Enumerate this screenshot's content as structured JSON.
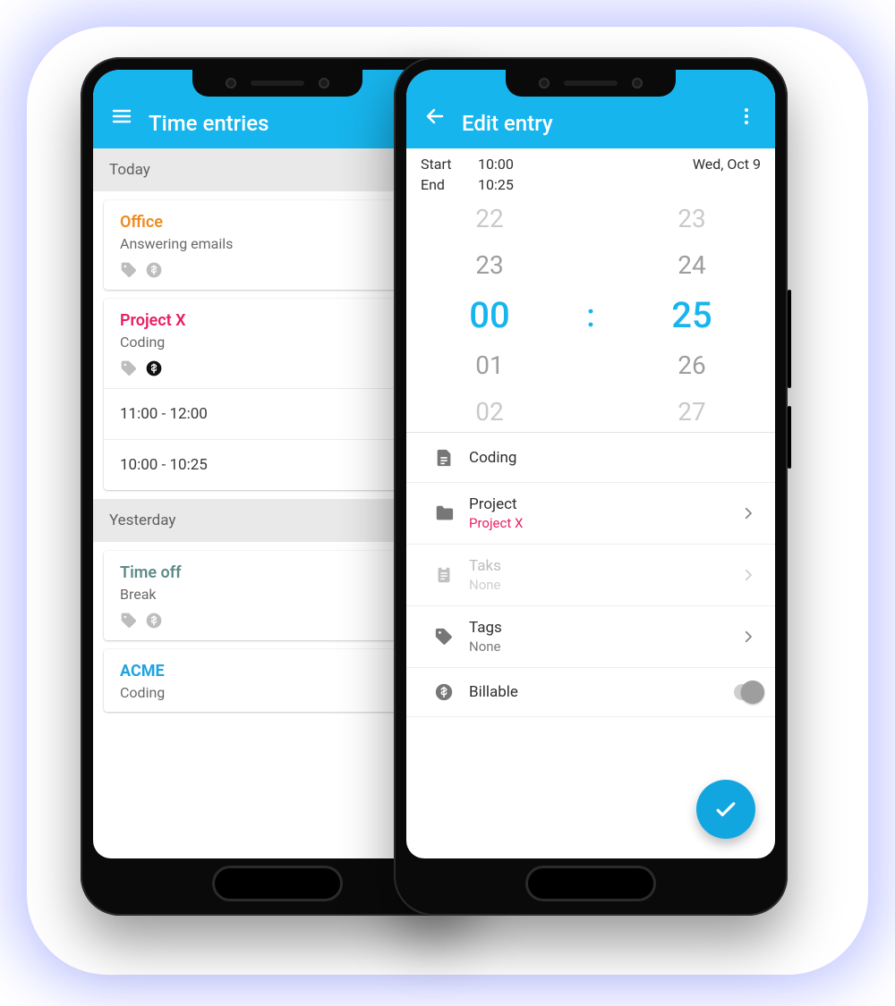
{
  "colors": {
    "primary": "#17b5ed",
    "orange": "#f08a1d",
    "pink": "#e91e63",
    "teal": "#5d8a8a",
    "blue": "#1fa4e0"
  },
  "left": {
    "title": "Time entries",
    "sections": [
      {
        "header": "Today",
        "cards": [
          {
            "project": "Office",
            "project_color": "orange",
            "description": "Answering emails",
            "billable_active": false,
            "sub_rows": []
          },
          {
            "project": "Project X",
            "project_color": "pink",
            "description": "Coding",
            "billable_active": true,
            "sub_rows": [
              "11:00 - 12:00",
              "10:00 - 10:25"
            ]
          }
        ]
      },
      {
        "header": "Yesterday",
        "cards": [
          {
            "project": "Time off",
            "project_color": "teal",
            "description": "Break",
            "billable_active": false,
            "sub_rows": []
          },
          {
            "project": "ACME",
            "project_color": "blue",
            "description": "Coding",
            "billable_active": false,
            "sub_rows": []
          }
        ]
      }
    ]
  },
  "right": {
    "title": "Edit entry",
    "start_label": "Start",
    "start_value": "10:00",
    "end_label": "End",
    "end_value": "10:25",
    "date": "Wed, Oct 9",
    "wheel": {
      "hours": [
        "22",
        "23",
        "00",
        "01",
        "02"
      ],
      "minutes": [
        "23",
        "24",
        "25",
        "26",
        "27"
      ],
      "selected_hour": "00",
      "selected_minute": "25"
    },
    "description": "Coding",
    "project_label": "Project",
    "project_value": "Project X",
    "task_label": "Taks",
    "task_value": "None",
    "tags_label": "Tags",
    "tags_value": "None",
    "billable_label": "Billable",
    "billable_on": false
  }
}
